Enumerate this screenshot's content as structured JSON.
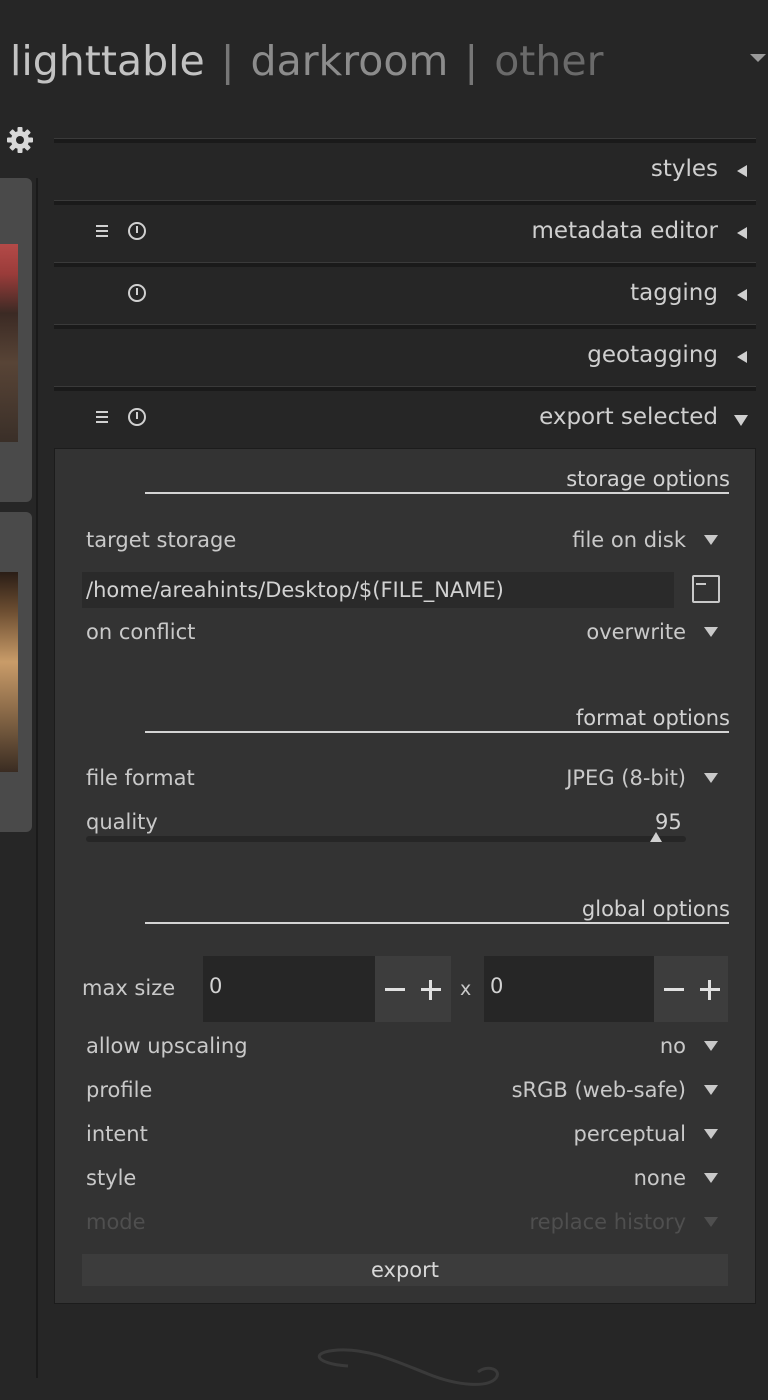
{
  "views": {
    "lighttable": "lighttable",
    "darkroom": "darkroom",
    "other": "other",
    "separator": "|"
  },
  "modules": [
    {
      "title": "styles"
    },
    {
      "title": "metadata editor"
    },
    {
      "title": "tagging"
    },
    {
      "title": "geotagging"
    },
    {
      "title": "export selected"
    }
  ],
  "export": {
    "storage_options": "storage options",
    "target_storage_label": "target storage",
    "target_storage_value": "file on disk",
    "path": "/home/areahints/Desktop/$(FILE_NAME)",
    "on_conflict_label": "on conflict",
    "on_conflict_value": "overwrite",
    "format_options": "format options",
    "file_format_label": "file format",
    "file_format_value": "JPEG (8-bit)",
    "quality_label": "quality",
    "quality_value": "95",
    "global_options": "global options",
    "max_size_label": "max size",
    "max_width": "0",
    "max_height": "0",
    "x_sep": "x",
    "allow_upscaling_label": "allow upscaling",
    "allow_upscaling_value": "no",
    "profile_label": "profile",
    "profile_value": "sRGB (web-safe)",
    "intent_label": "intent",
    "intent_value": "perceptual",
    "style_label": "style",
    "style_value": "none",
    "mode_label": "mode",
    "mode_value": "replace history",
    "export_button": "export"
  }
}
